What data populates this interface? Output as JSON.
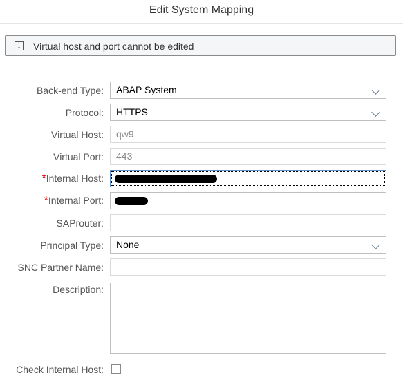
{
  "dialog": {
    "title": "Edit System Mapping"
  },
  "message": {
    "icon": "info-icon",
    "text": "Virtual host and port cannot be edited"
  },
  "form": {
    "backend_type": {
      "label": "Back-end Type:",
      "value": "ABAP System"
    },
    "protocol": {
      "label": "Protocol:",
      "value": "HTTPS"
    },
    "virtual_host": {
      "label": "Virtual Host:",
      "value": "qw9"
    },
    "virtual_port": {
      "label": "Virtual Port:",
      "value": "443"
    },
    "internal_host": {
      "label": "Internal Host:",
      "required": "*"
    },
    "internal_port": {
      "label": "Internal Port:",
      "required": "*"
    },
    "saprouter": {
      "label": "SAProuter:",
      "value": ""
    },
    "principal_type": {
      "label": "Principal Type:",
      "value": "None"
    },
    "snc_partner": {
      "label": "SNC Partner Name:",
      "value": ""
    },
    "description": {
      "label": "Description:",
      "value": ""
    },
    "check_internal_host": {
      "label": "Check Internal Host:",
      "checked": false
    }
  }
}
